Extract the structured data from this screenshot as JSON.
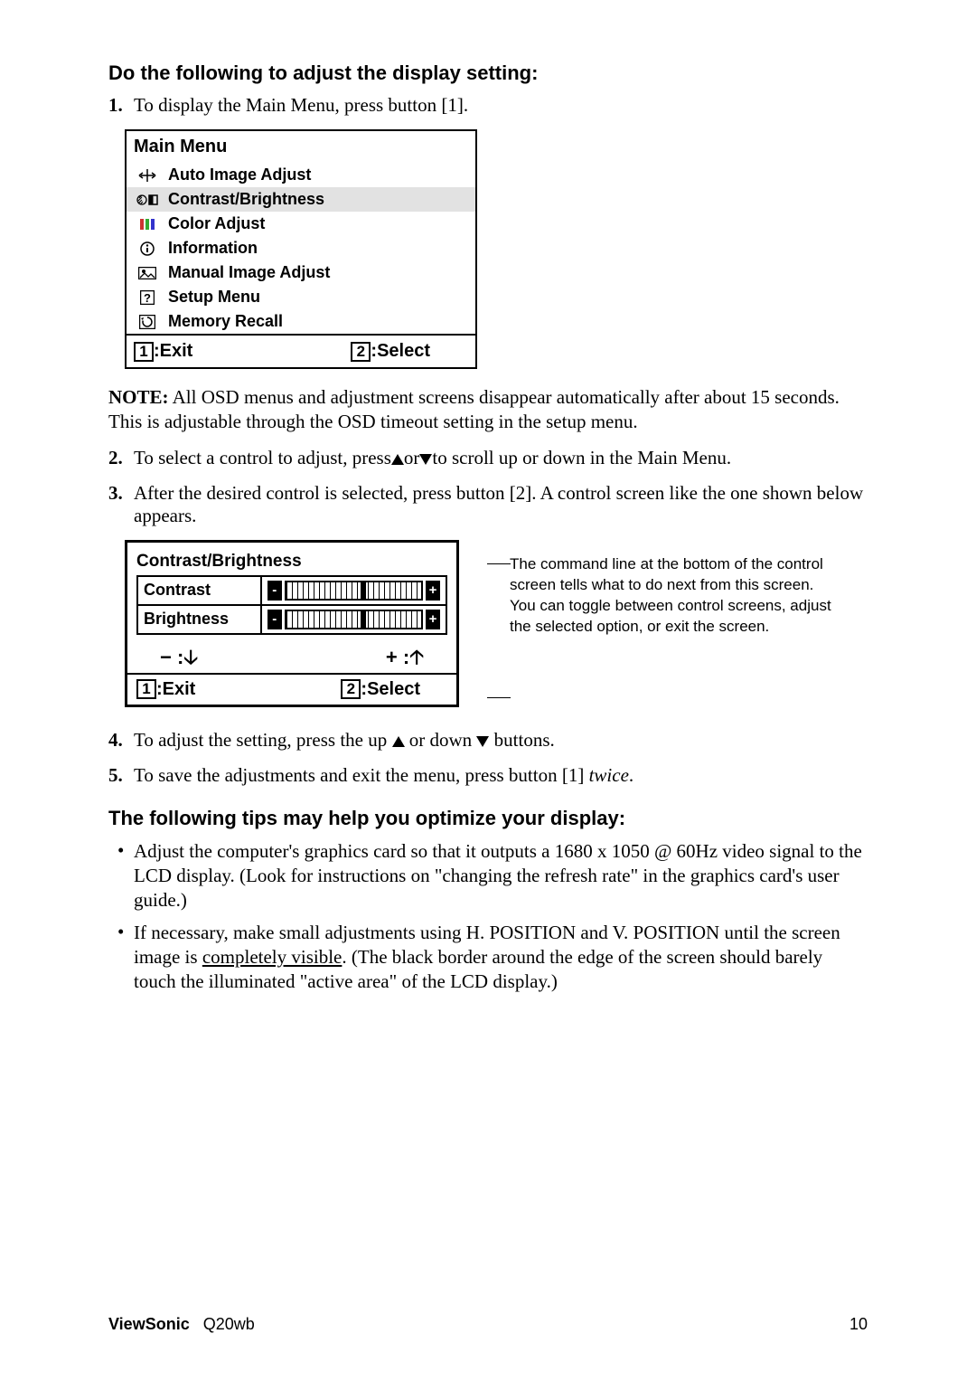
{
  "section1_title": "Do the following to adjust the display setting:",
  "step1_num": "1.",
  "step1_text": "To display the Main Menu, press button [1].",
  "mainmenu": {
    "title": "Main Menu",
    "items": [
      "Auto Image Adjust",
      "Contrast/Brightness",
      "Color Adjust",
      "Information",
      "Manual Image Adjust",
      "Setup Menu",
      "Memory Recall"
    ],
    "exit_key": "1",
    "exit_label": ":Exit",
    "select_key": "2",
    "select_label": ":Select"
  },
  "note_label": "NOTE:",
  "note_text": " All OSD menus and adjustment screens disappear automatically after about 15 seconds. This is adjustable through the OSD timeout setting in the setup menu.",
  "step2_num": "2.",
  "step2_pre": "To select a control to adjust, press",
  "step2_mid": "or",
  "step2_post": "to scroll up or down in the Main Menu.",
  "step3_num": "3.",
  "step3_text": "After the desired control is selected, press button [2]. A control screen like the one shown below appears.",
  "cb": {
    "title": "Contrast/Brightness",
    "contrast_label": "Contrast",
    "brightness_label": "Brightness",
    "minus": "− :",
    "plus": "+ :",
    "exit_key": "1",
    "exit_label": ":Exit",
    "select_key": "2",
    "select_label": ":Select"
  },
  "caption_text": "The command line at the bottom of the control screen tells what to do next from this screen. You can toggle between control screens, adjust the selected option, or exit the screen.",
  "step4_num": "4.",
  "step4_pre": "To adjust the setting, press the up ",
  "step4_mid": " or down ",
  "step4_post": " buttons.",
  "step5_num": "5.",
  "step5_pre": "To save the adjustments and exit the menu, press button [1] ",
  "step5_it": "twice",
  "step5_post": ".",
  "section2_title": "The following tips may help you optimize your display:",
  "tip1": "Adjust the computer's graphics card so that it outputs a 1680 x 1050 @ 60Hz video signal to the LCD display. (Look for instructions on \"changing the refresh rate\" in the graphics card's user guide.)",
  "tip2_pre": "If necessary, make small adjustments using H. POSITION and V. POSITION until the screen image is ",
  "tip2_ul": "completely visible",
  "tip2_post": ". (The black border around the edge of the screen should barely touch the illuminated \"active area\" of the LCD display.)",
  "footer_brand": "ViewSonic",
  "footer_model": "Q20wb",
  "footer_page": "10"
}
